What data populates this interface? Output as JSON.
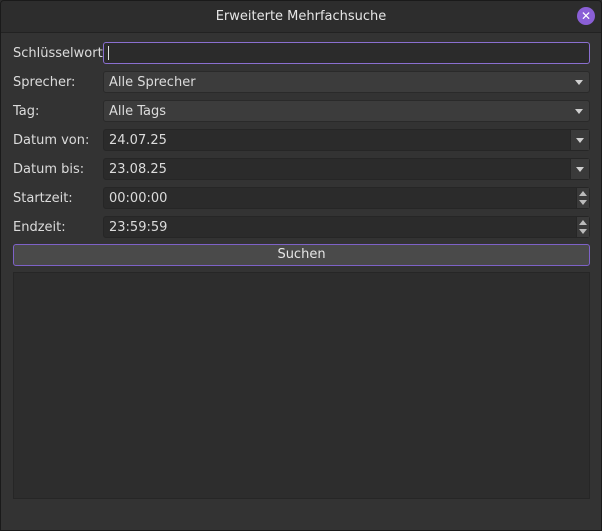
{
  "window": {
    "title": "Erweiterte Mehrfachsuche",
    "close_icon": "close-icon"
  },
  "form": {
    "keyword": {
      "label": "Schlüsselwort:",
      "value": ""
    },
    "speaker": {
      "label": "Sprecher:",
      "value": "Alle Sprecher"
    },
    "tag": {
      "label": "Tag:",
      "value": "Alle Tags"
    },
    "date_from": {
      "label": "Datum von:",
      "value": "24.07.25"
    },
    "date_to": {
      "label": "Datum bis:",
      "value": "23.08.25"
    },
    "start_time": {
      "label": "Startzeit:",
      "value": "00:00:00"
    },
    "end_time": {
      "label": "Endzeit:",
      "value": "23:59:59"
    }
  },
  "actions": {
    "search_label": "Suchen"
  },
  "colors": {
    "accent": "#8a5fd6"
  }
}
